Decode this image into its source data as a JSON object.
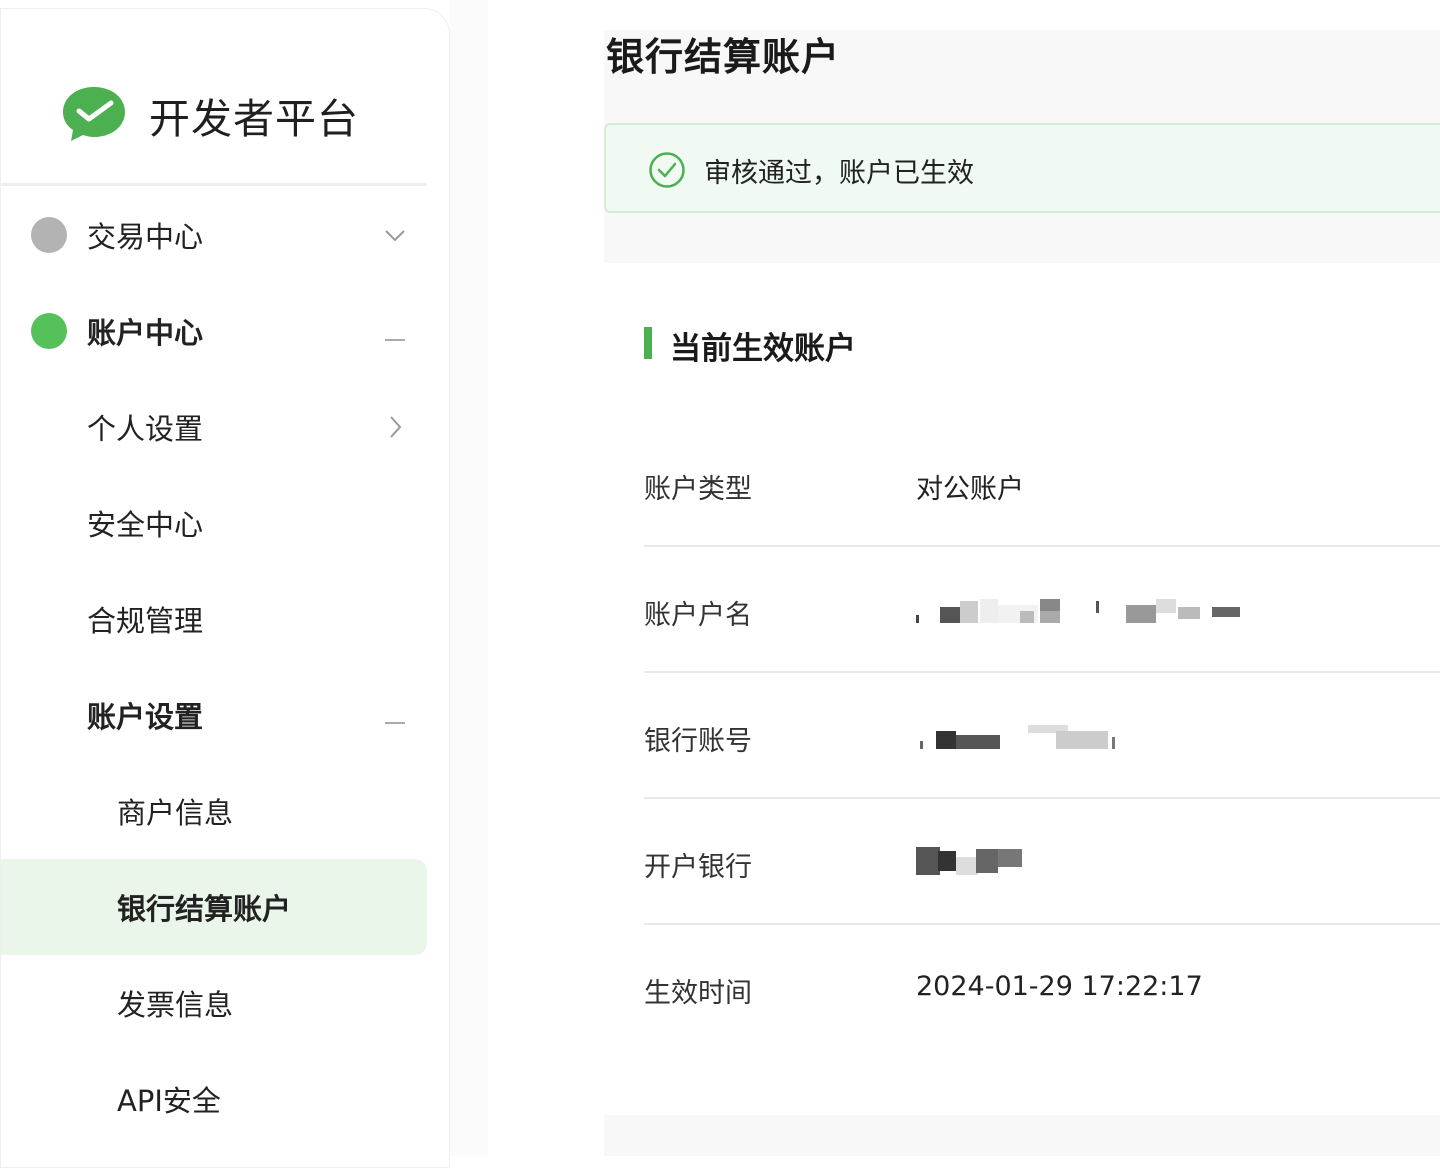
{
  "sidebar": {
    "brand_title": "开发者平台",
    "items": [
      {
        "label": "交易中心",
        "dot_color": "#b3b3b3",
        "arrow": "chevron-down"
      },
      {
        "label": "账户中心",
        "dot_color": "#55c15a",
        "arrow": "collapse-dash"
      },
      {
        "label": "个人设置",
        "arrow": "chevron-right"
      },
      {
        "label": "安全中心"
      },
      {
        "label": "合规管理"
      },
      {
        "label": "账户设置",
        "arrow": "collapse-dash"
      },
      {
        "label": "商户信息"
      },
      {
        "label": "银行结算账户",
        "active": true
      },
      {
        "label": "发票信息"
      },
      {
        "label": "API安全"
      }
    ]
  },
  "main": {
    "title": "银行结算账户",
    "alert_text": "审核通过，账户已生效",
    "section_title": "当前生效账户",
    "rows": [
      {
        "key": "账户类型",
        "value": "对公账户"
      },
      {
        "key": "账户户名",
        "value": ""
      },
      {
        "key": "银行账号",
        "value": ""
      },
      {
        "key": "开户银行",
        "value": ""
      },
      {
        "key": "生效时间",
        "value": "2024-01-29 17:22:17"
      }
    ]
  },
  "colors": {
    "accent": "#4caf50",
    "active_bg": "#eaf6ea",
    "alert_bg": "#f0f9f2"
  }
}
